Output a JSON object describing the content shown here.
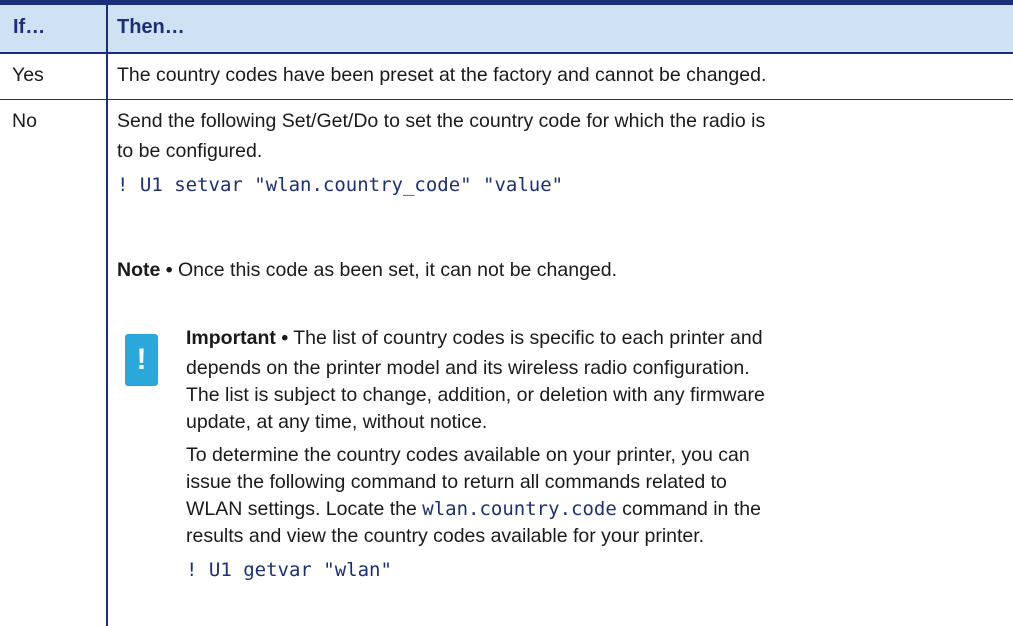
{
  "table": {
    "header": {
      "if": "If…",
      "then": "Then…"
    },
    "rows": [
      {
        "if": "Yes",
        "then": "The country codes have been preset at the factory and cannot be changed."
      },
      {
        "if": "No",
        "then_line1": "Send the following Set/Get/Do to set the country code for which the radio is",
        "then_line2": "to be configured.",
        "command": "! U1 setvar \"wlan.country_code\" \"value\"",
        "note_label": "Note •",
        "note_text": " Once this code as been set, it can not be changed.",
        "important_label": "Important •",
        "important_line1": " The list of country codes is specific to each printer and",
        "important_line2": "depends on the printer model and its wireless radio configuration.",
        "important_line3": "The list is subject to change, addition, or deletion with any firmware",
        "important_line4": "update, at any time, without notice.",
        "determine_line1": "To determine the country codes available on your printer, you can",
        "determine_line2": "issue the following command to return all commands related to",
        "determine_line3a": "WLAN settings. Locate the ",
        "determine_code": "wlan.country.code",
        "determine_line3b": " command in the",
        "determine_line4": "results and view the country codes available for your printer.",
        "getvar_command": "! U1 getvar \"wlan\""
      }
    ]
  },
  "icons": {
    "important": "exclamation-icon",
    "important_glyph": "!"
  },
  "colors": {
    "header_bg": "#cfe2f3",
    "rule": "#1b2f78",
    "code": "#1b2f78",
    "icon_bg": "#2aa8dc"
  }
}
